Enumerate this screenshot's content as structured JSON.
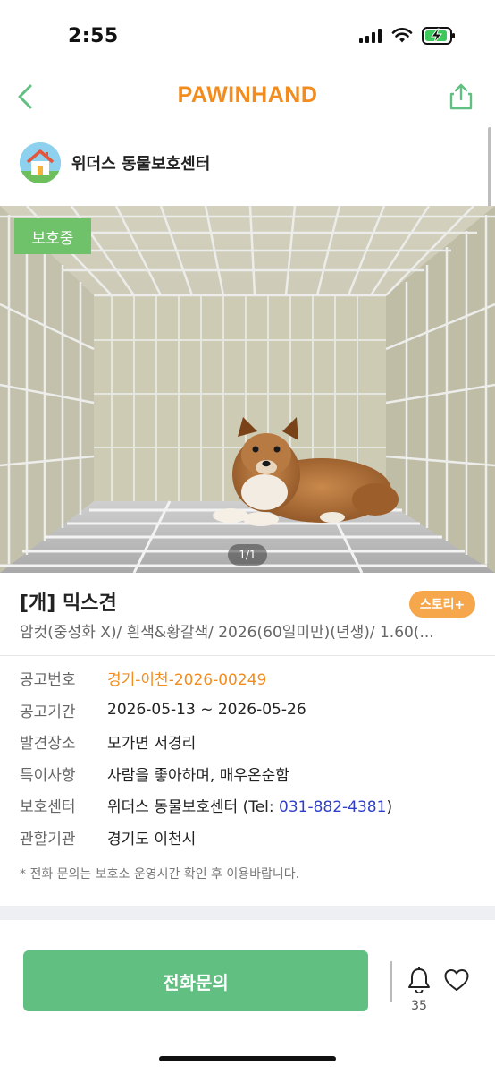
{
  "status_bar": {
    "time": "2:55"
  },
  "nav": {
    "brand": "PAWINHAND"
  },
  "shelter": {
    "name": "위더스 동물보호센터"
  },
  "photo": {
    "status_badge": "보호중",
    "page_indicator": "1/1"
  },
  "pet": {
    "title": "[개] 믹스견",
    "story_label": "스토리+",
    "summary": "암컷(중성화 X)/ 흰색&황갈색/ 2026(60일미만)(년생)/ 1.60(..."
  },
  "info": {
    "rows": [
      {
        "label": "공고번호",
        "value": "경기-이천-2026-00249"
      },
      {
        "label": "공고기간",
        "value": "2026-05-13 ~ 2026-05-26"
      },
      {
        "label": "발견장소",
        "value": "모가면 서경리"
      },
      {
        "label": "특이사항",
        "value": "사람을 좋아하며, 매우온순함"
      },
      {
        "label": "보호센터",
        "value_prefix": "위더스 동물보호센터 (Tel: ",
        "tel": "031-882-4381",
        "value_suffix": ")"
      },
      {
        "label": "관할기관",
        "value": "경기도 이천시"
      }
    ],
    "notice": "* 전화 문의는 보호소 운영시간 확인 후 이용바랍니다."
  },
  "actions": {
    "call_label": "전화문의",
    "bell_count": "35"
  },
  "colors": {
    "brand": "#f28c1f",
    "green": "#61bf82",
    "badge": "#6fc16a",
    "story": "#f7a74b",
    "link": "#2f3fc9"
  }
}
